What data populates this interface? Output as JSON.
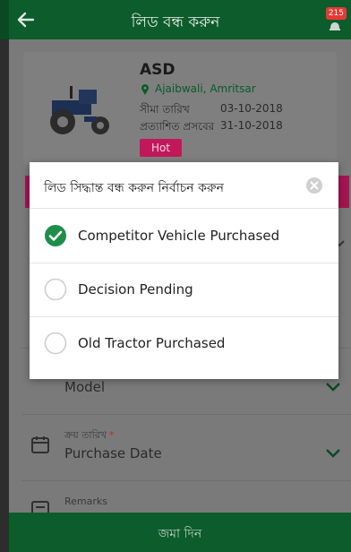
{
  "header": {
    "title": "লিড বন্ধ করুন",
    "notification_count": "215"
  },
  "lead_card": {
    "customer_name": "ASD",
    "location": "Ajaibwali, Amritsar",
    "dates": [
      {
        "label": "সীমা তারিখ",
        "value": "03-10-2018"
      },
      {
        "label": "প্রত্যাশিত প্রসবের",
        "value": "31-10-2018"
      }
    ],
    "status_badge": "Hot"
  },
  "form": {
    "model_field": {
      "value": "Model"
    },
    "purchase_date_field": {
      "label": "ক্রয় তারিখ",
      "required_mark": "*",
      "value": "Purchase Date"
    },
    "remarks_field": {
      "label": "Remarks"
    }
  },
  "submit": {
    "label": "জমা দিন"
  },
  "modal": {
    "title": "লিড সিদ্ধান্ত বন্ধ করুন নির্বাচন করুন",
    "options": [
      {
        "label": "Competitor Vehicle Purchased",
        "selected": true
      },
      {
        "label": "Decision Pending",
        "selected": false
      },
      {
        "label": "Old Tractor Purchased",
        "selected": false
      }
    ]
  },
  "colors": {
    "header_green": "#0d5c2c",
    "accent_green": "#1e8e4a",
    "hot_pink": "#c2185b",
    "badge_red": "#e53935"
  },
  "icons": [
    "back-arrow-icon",
    "bell-icon",
    "location-pin-icon",
    "tractor-image",
    "calendar-icon",
    "notes-icon",
    "chevron-down-icon",
    "close-icon",
    "check-circle-icon",
    "radio-empty-icon"
  ]
}
